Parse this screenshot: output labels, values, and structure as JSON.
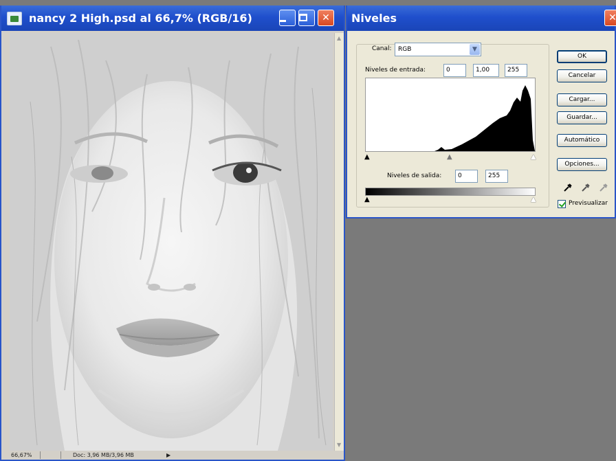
{
  "image_window": {
    "title": "nancy 2 High.psd al 66,7% (RGB/16)",
    "status_zoom": "66,67%",
    "status_doc": "Doc: 3,96 MB/3,96 MB"
  },
  "levels_dialog": {
    "title": "Niveles",
    "channel_label": "Canal:",
    "channel_value": "RGB",
    "input_label": "Niveles de entrada:",
    "input_black": "0",
    "input_gamma": "1,00",
    "input_white": "255",
    "output_label": "Niveles de salida:",
    "output_black": "0",
    "output_white": "255",
    "buttons": {
      "ok": "OK",
      "cancel": "Cancelar",
      "load": "Cargar...",
      "save": "Guardar...",
      "auto": "Automático",
      "options": "Opciones..."
    },
    "preview_label": "Previsualizar",
    "preview_checked": true
  },
  "colors": {
    "titlebar": "#1f4fcc",
    "workspace": "#7a7a7a",
    "dialog_bg": "#ece9d8"
  }
}
